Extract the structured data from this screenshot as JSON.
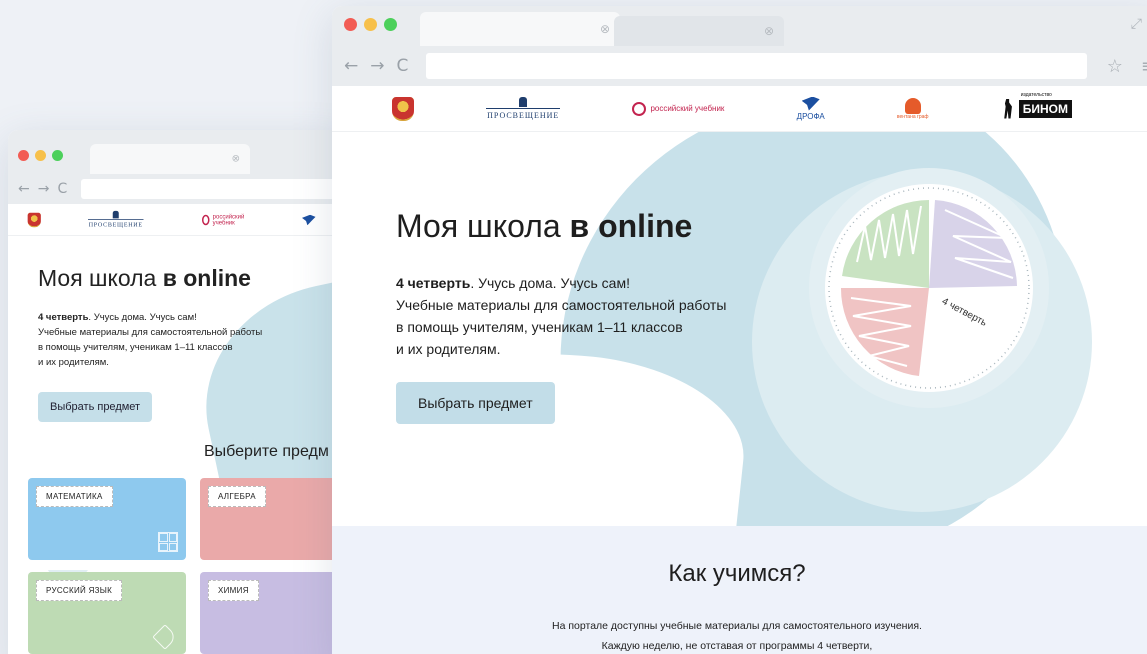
{
  "back_browser": {
    "h1_plain": "Моя школа ",
    "h1_bold": "в online",
    "quarter": "4 четверть",
    "line1_rest": ". Учусь дома. Учусь сам!",
    "line2": "Учебные материалы для самостоятельной работы",
    "line3": "в помощь учителям, ученикам 1–11 классов",
    "line4": "и их родителям.",
    "cta": "Выбрать предмет",
    "choose_title": "Выберите предм",
    "subjects": [
      {
        "label": "МАТЕМАТИКА",
        "color": "#8ec9ee"
      },
      {
        "label": "АЛГЕБРА",
        "color": "#eaa9a9"
      },
      {
        "label": "РУССКИЙ ЯЗЫК",
        "color": "#bedbb4"
      },
      {
        "label": "ХИМИЯ",
        "color": "#c7bde2"
      }
    ]
  },
  "front_browser": {
    "logos": {
      "prosveschenie": "ПРОСВЕЩЕНИЕ",
      "ru_textbook": "российский учебник",
      "drofa": "ДРОФА",
      "ventana": "вентана граф",
      "binom_sup": "издательство",
      "binom": "БИНОМ"
    },
    "h1_plain": "Моя школа ",
    "h1_bold": "в online",
    "quarter": "4 четверть",
    "line1_rest": ". Учусь дома. Учусь сам!",
    "line2": "Учебные материалы для самостоятельной работы",
    "line3": "в помощь учителям, ученикам 1–11 классов",
    "line4": "и их родителям.",
    "cta": "Выбрать предмет",
    "dial_label": "4 четверть",
    "how_title": "Как учимся?",
    "how_line1": "На портале доступны учебные материалы для самостоятельного изучения.",
    "how_line2": "Каждую неделю, не отставая от программы 4 четверти,"
  },
  "chrome": {
    "back_glyph": "←",
    "forward_glyph": "→",
    "reload_glyph": "C",
    "tab_close_glyph": "⊗",
    "star_glyph": "☆",
    "menu_glyph": "≡",
    "expand_glyph": "⤢"
  },
  "colors": {
    "accent_blue": "#c8e1ea",
    "button": "#c2dde8",
    "section_bg": "#eef2fa"
  }
}
